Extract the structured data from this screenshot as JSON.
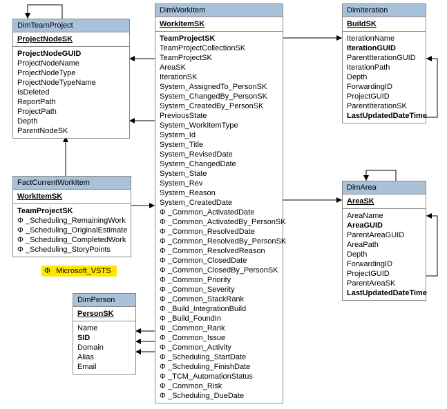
{
  "entities": {
    "dimTeamProject": {
      "title": "DimTeamProject",
      "pk": "ProjectNodeSK",
      "fields": [
        {
          "label": "ProjectNodeGUID",
          "bold": true
        },
        {
          "label": "ProjectNodeName"
        },
        {
          "label": "ProjectNodeType"
        },
        {
          "label": "ProjectNodeTypeName"
        },
        {
          "label": "IsDeleted"
        },
        {
          "label": "ReportPath"
        },
        {
          "label": "ProjectPath"
        },
        {
          "label": "Depth"
        },
        {
          "label": "ParentNodeSK"
        }
      ]
    },
    "factCurrentWorkItem": {
      "title": "FactCurrentWorkItem",
      "pk": "WorkItemSK",
      "fields": [
        {
          "label": "TeamProjectSK",
          "bold": true
        },
        {
          "label": "_Scheduling_RemainingWork",
          "prefix": "Φ"
        },
        {
          "label": "_Scheduling_OriginalEstimate",
          "prefix": "Φ"
        },
        {
          "label": "_Scheduling_CompletedWork",
          "prefix": "Φ"
        },
        {
          "label": "_Scheduling_StoryPoints",
          "prefix": "Φ"
        }
      ]
    },
    "dimPerson": {
      "title": "DimPerson",
      "pk": "PersonSK",
      "fields": [
        {
          "label": "Name"
        },
        {
          "label": "SID",
          "bold": true
        },
        {
          "label": "Domain"
        },
        {
          "label": "Alias"
        },
        {
          "label": "Email"
        }
      ]
    },
    "dimWorkItem": {
      "title": "DimWorkItem",
      "pk": "WorkItemSK",
      "fields": [
        {
          "label": "TeamProjectSK",
          "bold": true
        },
        {
          "label": "TeamProjectCollectionSK"
        },
        {
          "label": "TeamProjectSK"
        },
        {
          "label": "AreaSK"
        },
        {
          "label": "IterationSK"
        },
        {
          "label": "System_AssignedTo_PersonSK"
        },
        {
          "label": "System_ChangedBy_PersonSK"
        },
        {
          "label": "System_CreatedBy_PersonSK"
        },
        {
          "label": "PreviousState"
        },
        {
          "label": "System_WorkItemType"
        },
        {
          "label": "System_Id"
        },
        {
          "label": "System_Title"
        },
        {
          "label": "System_RevisedDate"
        },
        {
          "label": "System_ChangedDate"
        },
        {
          "label": "System_State"
        },
        {
          "label": "System_Rev"
        },
        {
          "label": "System_Reason"
        },
        {
          "label": "System_CreatedDate"
        },
        {
          "label": "_Common_ActivatedDate",
          "prefix": "Φ"
        },
        {
          "label": "_Common_ActivatedBy_PersonSK",
          "prefix": "Φ"
        },
        {
          "label": "_Common_ResolvedDate",
          "prefix": "Φ"
        },
        {
          "label": "_Common_ResolvedBy_PersonSK",
          "prefix": "Φ"
        },
        {
          "label": "_Common_ResolvedReason",
          "prefix": "Φ"
        },
        {
          "label": "_Common_ClosedDate",
          "prefix": "Φ"
        },
        {
          "label": "_Common_ClosedBy_PersonSK",
          "prefix": "Φ"
        },
        {
          "label": "_Common_Priority",
          "prefix": "Φ"
        },
        {
          "label": "_Common_Severity",
          "prefix": "Φ"
        },
        {
          "label": "_Common_StackRank",
          "prefix": "Φ"
        },
        {
          "label": "_Build_IntegrationBuild",
          "prefix": "Φ"
        },
        {
          "label": "_Build_FoundIn",
          "prefix": "Φ"
        },
        {
          "label": "_Common_Rank",
          "prefix": "Φ"
        },
        {
          "label": "_Common_Issue",
          "prefix": "Φ"
        },
        {
          "label": "_Common_Activity",
          "prefix": "Φ"
        },
        {
          "label": "_Scheduling_StartDate",
          "prefix": "Φ"
        },
        {
          "label": "_Scheduling_FinishDate",
          "prefix": "Φ"
        },
        {
          "label": "_TCM_AutomationStatus",
          "prefix": "Φ"
        },
        {
          "label": "_Common_Risk",
          "prefix": "Φ"
        },
        {
          "label": "_Scheduling_DueDate",
          "prefix": "Φ"
        }
      ]
    },
    "dimIteration": {
      "title": "DimIteration",
      "pk": "BuildSK",
      "fields": [
        {
          "label": "IterationName"
        },
        {
          "label": "IterationGUID",
          "bold": true
        },
        {
          "label": "ParentIterationGUID"
        },
        {
          "label": "IterationPath"
        },
        {
          "label": "Depth"
        },
        {
          "label": "ForwardingID"
        },
        {
          "label": "ProjectGUID"
        },
        {
          "label": "ParentIterationSK"
        },
        {
          "label": "LastUpdatedDateTime",
          "bold": true
        }
      ]
    },
    "dimArea": {
      "title": "DimArea",
      "pk": "AreaSK",
      "fields": [
        {
          "label": "AreaName"
        },
        {
          "label": "AreaGUID",
          "bold": true
        },
        {
          "label": "ParentAreaGUID"
        },
        {
          "label": "AreaPath"
        },
        {
          "label": "Depth"
        },
        {
          "label": "ForwardingID"
        },
        {
          "label": "ProjectGUID"
        },
        {
          "label": "ParentAreaSK"
        },
        {
          "label": "LastUpdatedDateTime",
          "bold": true
        }
      ]
    }
  },
  "legend": {
    "prefix": "Φ",
    "label": "Microsoft_VSTS"
  }
}
